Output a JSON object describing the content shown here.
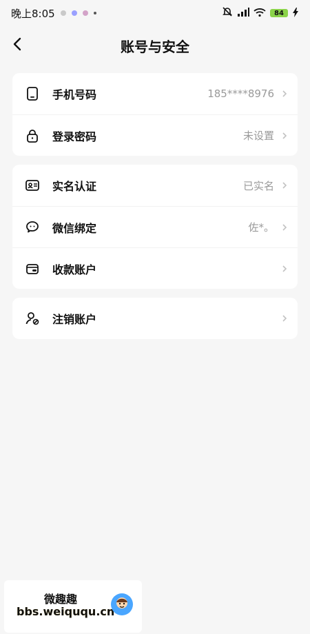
{
  "status_bar": {
    "time": "晚上8:05",
    "battery": "84"
  },
  "header": {
    "title": "账号与安全"
  },
  "sections": [
    {
      "items": [
        {
          "label": "手机号码",
          "value": "185****8976"
        },
        {
          "label": "登录密码",
          "value": "未设置"
        }
      ]
    },
    {
      "items": [
        {
          "label": "实名认证",
          "value": "已实名"
        },
        {
          "label": "微信绑定",
          "value": "佐*。"
        },
        {
          "label": "收款账户",
          "value": ""
        }
      ]
    },
    {
      "items": [
        {
          "label": "注销账户",
          "value": ""
        }
      ]
    }
  ],
  "watermark": {
    "line1": "微趣趣",
    "line2": "bbs.weiququ.cn"
  }
}
